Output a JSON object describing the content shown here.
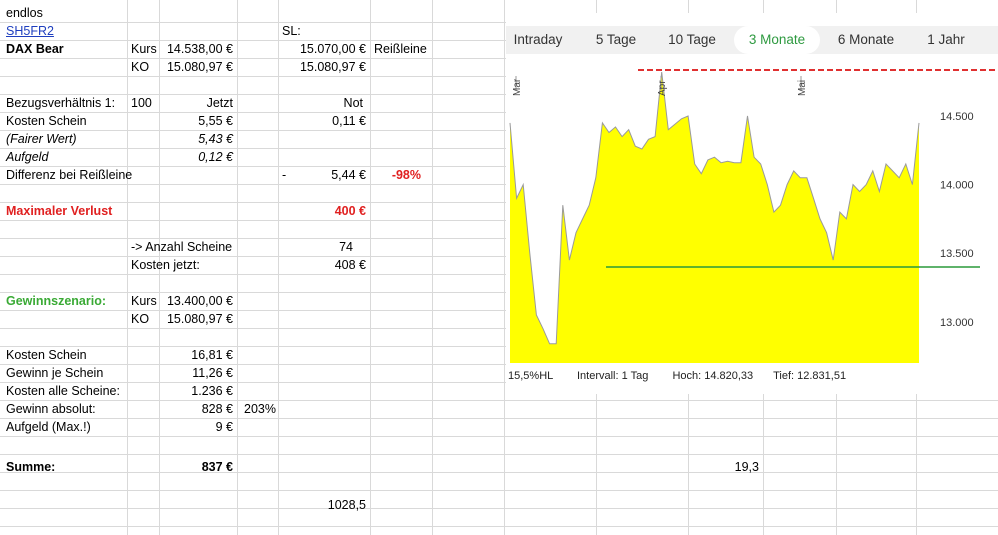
{
  "sheet": {
    "a1": "endlos",
    "link": "SH5FR2",
    "sl_label": "SL:",
    "product": "DAX Bear",
    "kurs_label": "Kurs",
    "kurs_value": "14.538,00 €",
    "sl_value": "15.070,00 €",
    "reissleine": "Reißleine",
    "ko_label": "KO",
    "ko_value": "15.080,97 €",
    "ko_value2": "15.080,97 €",
    "bezug_label": "Bezugsverhältnis 1:",
    "bezug_value": "100",
    "jetzt": "Jetzt",
    "not": "Not",
    "kosten_schein": "Kosten Schein",
    "kosten_schein_value": "5,55 €",
    "kosten_schein_not": "0,11 €",
    "fairer_wert": "(Fairer Wert)",
    "fairer_wert_value": "5,43 €",
    "aufgeld": "Aufgeld",
    "aufgeld_value": "0,12 €",
    "differenz": "Differenz bei Reißleine",
    "differenz_dash": "-",
    "differenz_value": "5,44 €",
    "differenz_pct": "-98%",
    "max_verlust": "Maximaler Verlust",
    "max_verlust_value": "400 €",
    "anzahl_label": "-> Anzahl Scheine",
    "anzahl_value": "74",
    "kosten_jetzt_label": "Kosten jetzt:",
    "kosten_jetzt_value": "408 €",
    "gewinnszenario": "Gewinnszenario:",
    "kurs2_label": "Kurs",
    "kurs2_value": "13.400,00 €",
    "ko2_label": "KO",
    "ko2_value": "15.080,97 €",
    "ks_label": "Kosten Schein",
    "ks_value": "16,81 €",
    "gjs_label": "Gewinn je Schein",
    "gjs_value": "11,26 €",
    "kas_label": "Kosten alle Scheine:",
    "kas_value": "1.236 €",
    "ga_label": "Gewinn absolut:",
    "ga_value": "828 €",
    "ga_pct": "203%",
    "agm_label": "Aufgeld (Max.!)",
    "agm_value": "9 €",
    "summe_label": "Summe:",
    "summe_value": "837 €",
    "extra_value": "19,3",
    "bottom_value": "1028,5"
  },
  "chart_panel": {
    "tabs": [
      "Intraday",
      "5 Tage",
      "10 Tage",
      "3 Monate",
      "6 Monate",
      "1 Jahr"
    ],
    "active_tab": "3 Monate",
    "month_labels": [
      "Mar",
      "Apr",
      "Mai"
    ],
    "footer": {
      "hl": "15,5%HL",
      "intervall": "Intervall: 1 Tag",
      "hoch": "Hoch:  14.820,33",
      "tief": "Tief:  12.831,51"
    },
    "colors": {
      "area": "#ffff00",
      "line": "#9a9a9a",
      "red_line": "#e03030",
      "green_line": "#2a9a3a",
      "active_tab": "#2e9a40"
    }
  },
  "chart_data": {
    "type": "area",
    "x_axis_labels": [
      "Mar",
      "Apr",
      "Mai"
    ],
    "ylim": [
      12700,
      14850
    ],
    "yticks": [
      13000,
      13500,
      14000,
      14500
    ],
    "ytick_labels": [
      "13.000",
      "13.500",
      "14.000",
      "14.500"
    ],
    "values": [
      14450,
      13900,
      14000,
      13500,
      13050,
      12950,
      12840,
      12840,
      13850,
      13450,
      13650,
      13750,
      13850,
      14050,
      14450,
      14380,
      14420,
      14350,
      14400,
      14280,
      14260,
      14330,
      14350,
      14820,
      14400,
      14440,
      14480,
      14500,
      14150,
      14080,
      14180,
      14200,
      14160,
      14170,
      14160,
      14160,
      14500,
      14200,
      14150,
      14000,
      13800,
      13850,
      14000,
      14100,
      14050,
      14050,
      13900,
      13750,
      13650,
      13450,
      13800,
      13750,
      14000,
      13950,
      14000,
      14100,
      13950,
      14150,
      14100,
      14050,
      14150,
      14000,
      14450
    ],
    "reference_lines": [
      {
        "style": "solid",
        "color": "#e03030",
        "value": 14920
      },
      {
        "style": "dashed",
        "color": "#e03030",
        "value": 14835
      },
      {
        "style": "solid",
        "color": "#2a9a3a",
        "value": 13400
      }
    ],
    "grid": false,
    "legend": "none"
  }
}
